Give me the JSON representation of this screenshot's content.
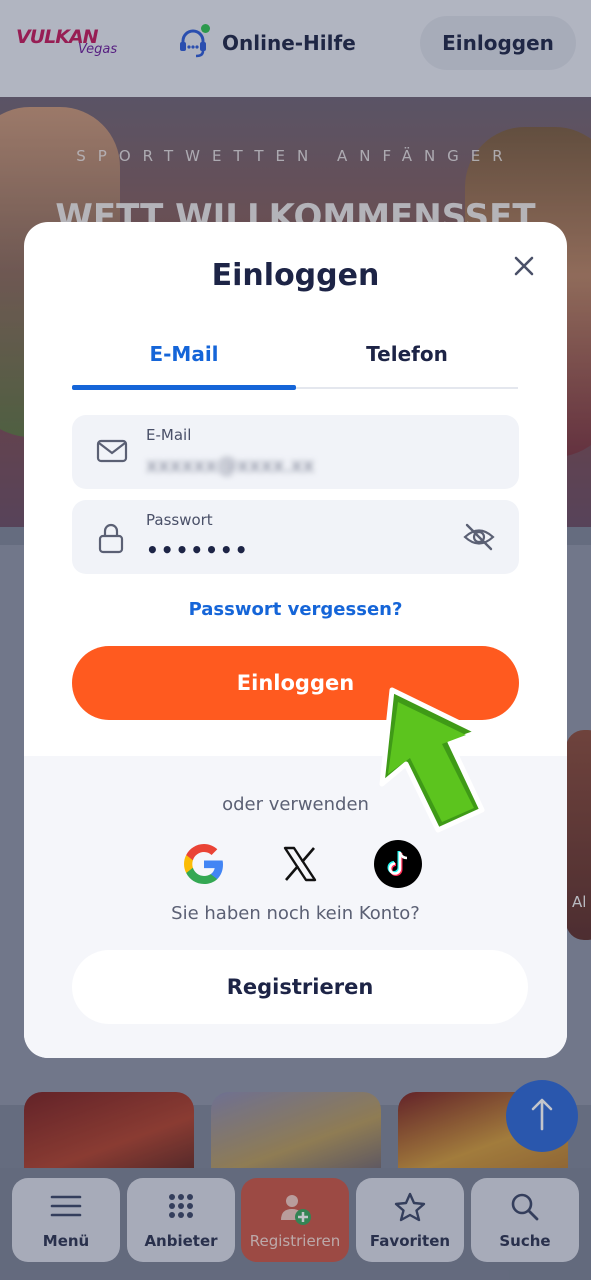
{
  "header": {
    "logo_main": "VULKAN",
    "logo_sub": "Vegas",
    "help_label": "Online-Hilfe",
    "login_label": "Einloggen"
  },
  "hero": {
    "kicker": "SPORTWETTEN ANFÄNGER",
    "title": "WETT WILLKOMMENSSET"
  },
  "side_card_text": "Al",
  "modal": {
    "title": "Einloggen",
    "tabs": [
      {
        "label": "E-Mail",
        "active": true
      },
      {
        "label": "Telefon",
        "active": false
      }
    ],
    "email_field": {
      "label": "E-Mail",
      "value": "xxxxxx@xxxx.xx"
    },
    "password_field": {
      "label": "Passwort",
      "value": "•••••••"
    },
    "forgot_label": "Passwort vergessen?",
    "login_button": "Einloggen",
    "or_use": "oder verwenden",
    "social": [
      "google-icon",
      "x-icon",
      "tiktok-icon"
    ],
    "no_account": "Sie haben noch kein Konto?",
    "register_button": "Registrieren"
  },
  "bottom_nav": [
    {
      "label": "Menü",
      "icon": "menu-icon"
    },
    {
      "label": "Anbieter",
      "icon": "grid-icon"
    },
    {
      "label": "Registrieren",
      "icon": "add-user-icon"
    },
    {
      "label": "Favoriten",
      "icon": "star-icon"
    },
    {
      "label": "Suche",
      "icon": "search-icon"
    }
  ],
  "colors": {
    "accent_blue": "#1565d8",
    "login_orange": "#ff5a1f",
    "pointer_green": "#4caf1a",
    "navy": "#1d2446"
  }
}
